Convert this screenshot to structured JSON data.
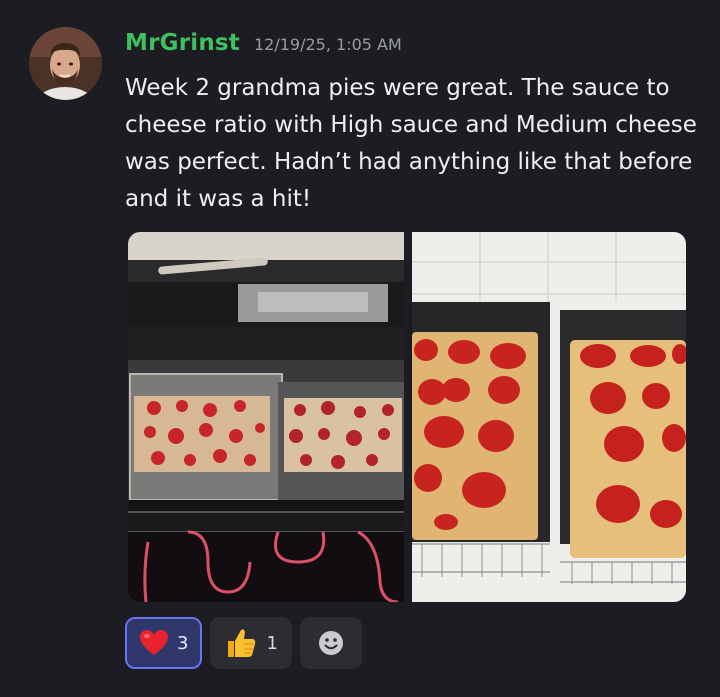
{
  "message": {
    "author": "MrGrinst",
    "timestamp": "12/19/25, 1:05 AM",
    "text": "Week 2 grandma pies were great. The sauce to cheese ratio with High sauce and Medium cheese was perfect. Hadn’t had anything like that before and it was a hit!"
  },
  "attachments": [
    {
      "icon": "oven-pizza-photo"
    },
    {
      "icon": "pizza-pans-photo"
    }
  ],
  "reactions": [
    {
      "emoji": "heart-icon",
      "count": "3",
      "active": true
    },
    {
      "emoji": "thumbs-up-icon",
      "count": "1",
      "active": false
    }
  ],
  "add_reaction": {
    "icon": "smiley-icon"
  },
  "colors": {
    "background": "#1c1d22",
    "username": "#3fbf5f",
    "active_reaction_border": "#6a74f0"
  }
}
